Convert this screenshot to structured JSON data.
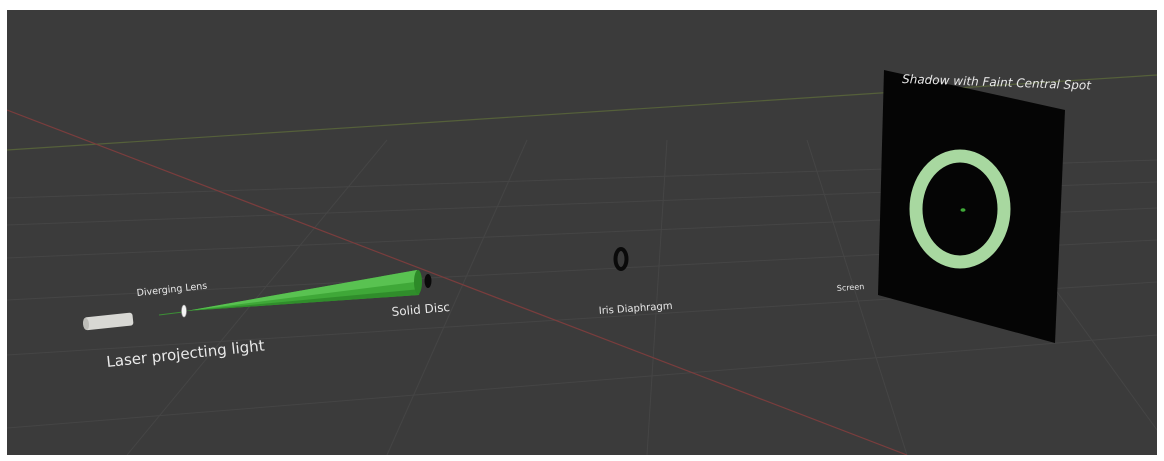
{
  "scene": {
    "labels": {
      "diverging_lens": "Diverging Lens",
      "laser": "Laser projecting light",
      "solid_disc": "Solid Disc",
      "iris_diaphragm": "Iris Diaphragm",
      "screen": "Screen",
      "shadow": "Shadow with Faint Central Spot"
    },
    "colors": {
      "background": "#3b3b3b",
      "grid": "#454545",
      "x_axis": "#7a3d3d",
      "y_axis": "#55603a",
      "beam": "#3fa838",
      "ring": "#a8d8a0",
      "screen": "#050505",
      "label": "#e9e9e9"
    }
  }
}
